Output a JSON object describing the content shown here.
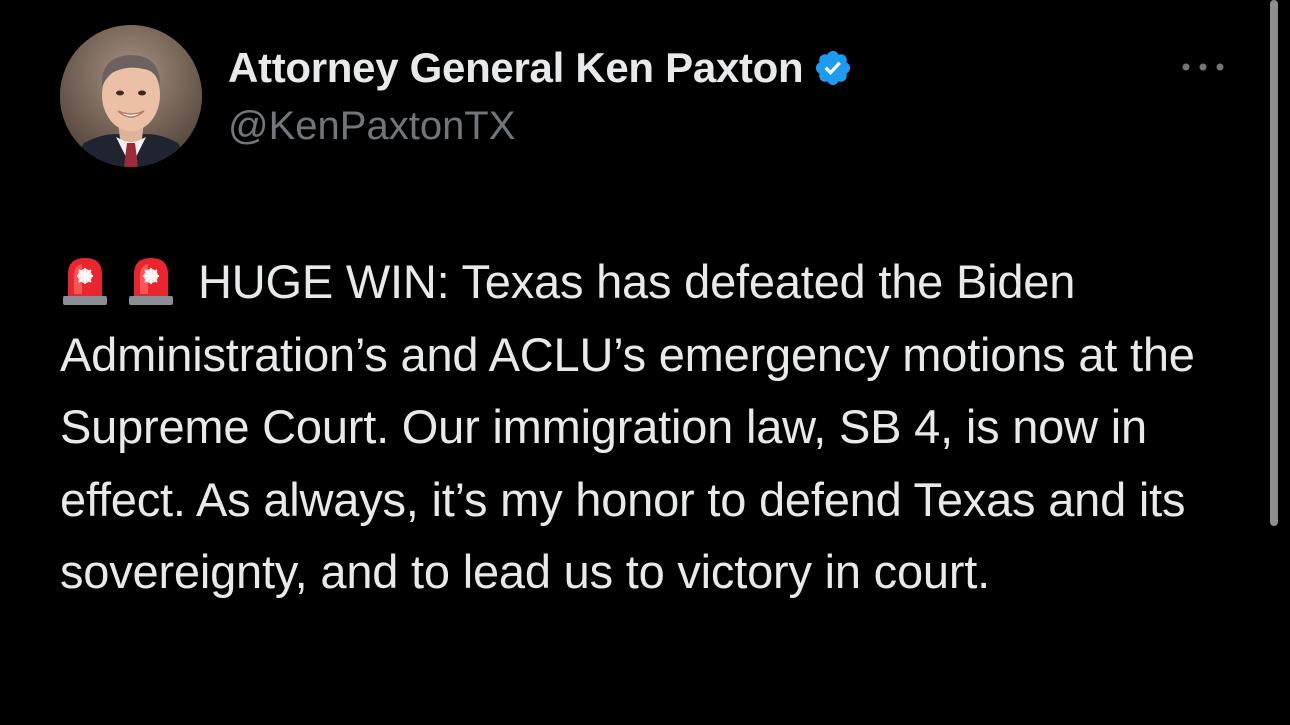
{
  "author": {
    "display_name": "Attorney General Ken Paxton",
    "handle": "@KenPaxtonTX",
    "verified": true,
    "verified_color": "#1d9bf0"
  },
  "tweet": {
    "emojis": [
      "police-car-light-icon",
      "police-car-light-icon"
    ],
    "text": "HUGE WIN: Texas has defeated the Biden Administration’s and ACLU’s emergency motions at the Supreme Court. Our immigration law, SB 4, is now in effect. As always, it’s my honor to defend Texas and its sovereignty, and to lead us to victory in court."
  },
  "menu": {
    "icon": "more-horizontal-icon"
  },
  "colors": {
    "background": "#000000",
    "text_primary": "#e7e9ea",
    "text_secondary": "#71767b"
  }
}
